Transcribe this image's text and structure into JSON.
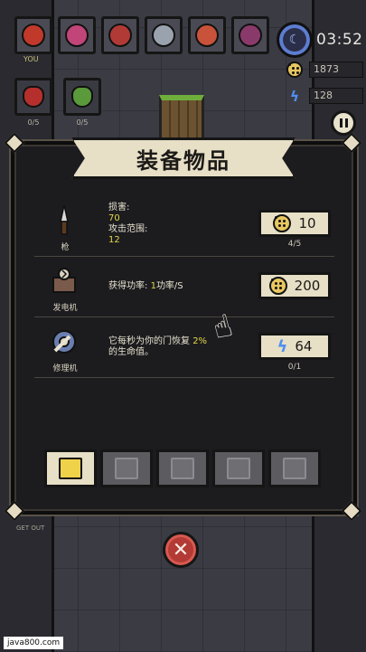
{
  "hud": {
    "you_label": "YOU",
    "timer": "03:52",
    "coins": "1873",
    "energy": "128",
    "players": [
      {
        "name": "player-slot-1",
        "color": "#c0392b"
      },
      {
        "name": "player-slot-2",
        "color": "#c2457a"
      },
      {
        "name": "player-slot-3",
        "color": "#b23a36"
      },
      {
        "name": "player-slot-4",
        "color": "#9aa3ad"
      },
      {
        "name": "player-slot-5",
        "color": "#c8523a"
      },
      {
        "name": "player-slot-6",
        "color": "#8a3a6a"
      }
    ],
    "enemies": [
      {
        "count": "0/5",
        "color": "#b5302c"
      },
      {
        "count": "0/5",
        "color": "#5a9a3a"
      }
    ]
  },
  "panel": {
    "title": "装备物品",
    "items": [
      {
        "name": "枪",
        "lines": [
          {
            "label": "损害:",
            "value": "70"
          },
          {
            "label": "攻击范围:",
            "value": "12"
          }
        ],
        "price": "10",
        "price_type": "coin",
        "sub": "4/5"
      },
      {
        "name": "发电机",
        "desc_prefix": "获得功率: ",
        "desc_value": "1",
        "desc_suffix": "功率/S",
        "price": "200",
        "price_type": "coin",
        "sub": ""
      },
      {
        "name": "修理机",
        "desc_line1_prefix": "它每秒为你的门恢复 ",
        "desc_line1_value": "2%",
        "desc_line2": "的生命值。",
        "price": "64",
        "price_type": "energy",
        "sub": "0/1"
      }
    ],
    "tabs": [
      "tab-tools",
      "tab-generator",
      "tab-repair",
      "tab-turret",
      "tab-trap"
    ]
  },
  "side_label": "GET OUT",
  "watermark": "java800.com",
  "colors": {
    "banner": "#e7dfc6",
    "highlight": "#e7d64a",
    "close": "#b33a35",
    "energy": "#4f8ff0"
  }
}
